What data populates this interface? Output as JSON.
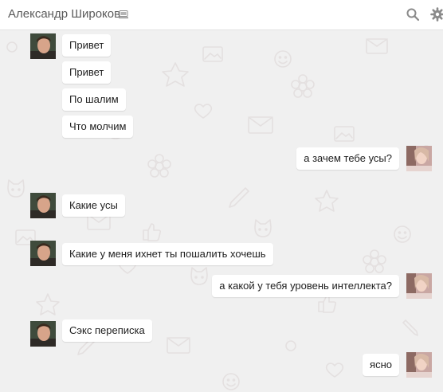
{
  "header": {
    "contact_name": "Александр Широков",
    "mobile_icon": "mobile-icon",
    "search_icon": "search-icon",
    "settings_icon": "gear-icon"
  },
  "messages": [
    {
      "from": "contact",
      "text": "Привет"
    },
    {
      "from": "contact",
      "text": "Привет"
    },
    {
      "from": "contact",
      "text": "По шалим"
    },
    {
      "from": "contact",
      "text": "Что молчим"
    },
    {
      "from": "me",
      "text": "а зачем тебе усы?"
    },
    {
      "from": "contact",
      "text": "Какие усы"
    },
    {
      "from": "contact",
      "text": "Какие у меня ихнет ты пошалить хочешь"
    },
    {
      "from": "me",
      "text": "а какой у тебя уровень интеллекта?"
    },
    {
      "from": "contact",
      "text": "Сэкс переписка"
    },
    {
      "from": "me",
      "text": "ясно"
    }
  ],
  "colors": {
    "background": "#f0f0f0",
    "bubble": "#ffffff",
    "header": "#ffffff",
    "pattern": "#e6e3e3"
  }
}
